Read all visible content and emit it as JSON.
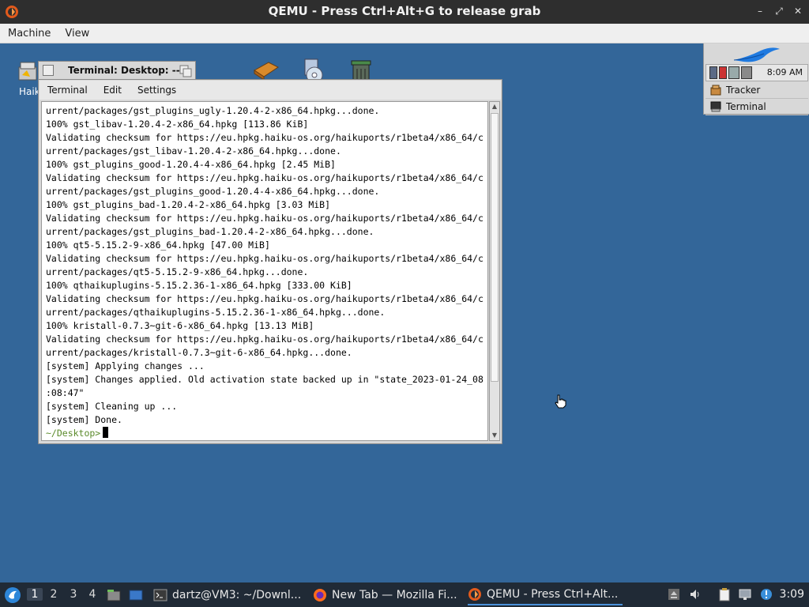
{
  "host_window": {
    "title": "QEMU - Press Ctrl+Alt+G to release grab",
    "min_symbol": "–",
    "max_symbol": "⤢",
    "close_symbol": "✕"
  },
  "host_menu": {
    "items": [
      "Machine",
      "View"
    ]
  },
  "desktop": {
    "icons": [
      {
        "label": "Haik"
      }
    ]
  },
  "deskbar": {
    "clock": "8:09 AM",
    "items": [
      {
        "label": "Tracker"
      },
      {
        "label": "Terminal"
      }
    ]
  },
  "terminal": {
    "title": "Terminal: Desktop: --",
    "menu": [
      "Terminal",
      "Edit",
      "Settings"
    ],
    "lines": [
      "urrent/packages/gst_plugins_ugly-1.20.4-2-x86_64.hpkg...done.",
      "100% gst_libav-1.20.4-2-x86_64.hpkg [113.86 KiB]",
      "Validating checksum for https://eu.hpkg.haiku-os.org/haikuports/r1beta4/x86_64/c",
      "urrent/packages/gst_libav-1.20.4-2-x86_64.hpkg...done.",
      "100% gst_plugins_good-1.20.4-4-x86_64.hpkg [2.45 MiB]",
      "Validating checksum for https://eu.hpkg.haiku-os.org/haikuports/r1beta4/x86_64/c",
      "urrent/packages/gst_plugins_good-1.20.4-4-x86_64.hpkg...done.",
      "100% gst_plugins_bad-1.20.4-2-x86_64.hpkg [3.03 MiB]",
      "Validating checksum for https://eu.hpkg.haiku-os.org/haikuports/r1beta4/x86_64/c",
      "urrent/packages/gst_plugins_bad-1.20.4-2-x86_64.hpkg...done.",
      "100% qt5-5.15.2-9-x86_64.hpkg [47.00 MiB]",
      "Validating checksum for https://eu.hpkg.haiku-os.org/haikuports/r1beta4/x86_64/c",
      "urrent/packages/qt5-5.15.2-9-x86_64.hpkg...done.",
      "100% qthaikuplugins-5.15.2.36-1-x86_64.hpkg [333.00 KiB]",
      "Validating checksum for https://eu.hpkg.haiku-os.org/haikuports/r1beta4/x86_64/c",
      "urrent/packages/qthaikuplugins-5.15.2.36-1-x86_64.hpkg...done.",
      "100% kristall-0.7.3~git-6-x86_64.hpkg [13.13 MiB]",
      "Validating checksum for https://eu.hpkg.haiku-os.org/haikuports/r1beta4/x86_64/c",
      "urrent/packages/kristall-0.7.3~git-6-x86_64.hpkg...done.",
      "[system] Applying changes ...",
      "[system] Changes applied. Old activation state backed up in \"state_2023-01-24_08",
      ":08:47\"",
      "[system] Cleaning up ...",
      "[system] Done."
    ],
    "prompt": "~/Desktop>"
  },
  "taskbar": {
    "workspaces": [
      "1",
      "2",
      "3",
      "4"
    ],
    "active_workspace": "1",
    "tasks": [
      {
        "label": "dartz@VM3: ~/Downl...",
        "icon": "terminal-icon"
      },
      {
        "label": "New Tab — Mozilla Fi...",
        "icon": "firefox-icon"
      },
      {
        "label": "QEMU - Press Ctrl+Alt...",
        "icon": "qemu-icon"
      }
    ],
    "clock": "3:09"
  }
}
